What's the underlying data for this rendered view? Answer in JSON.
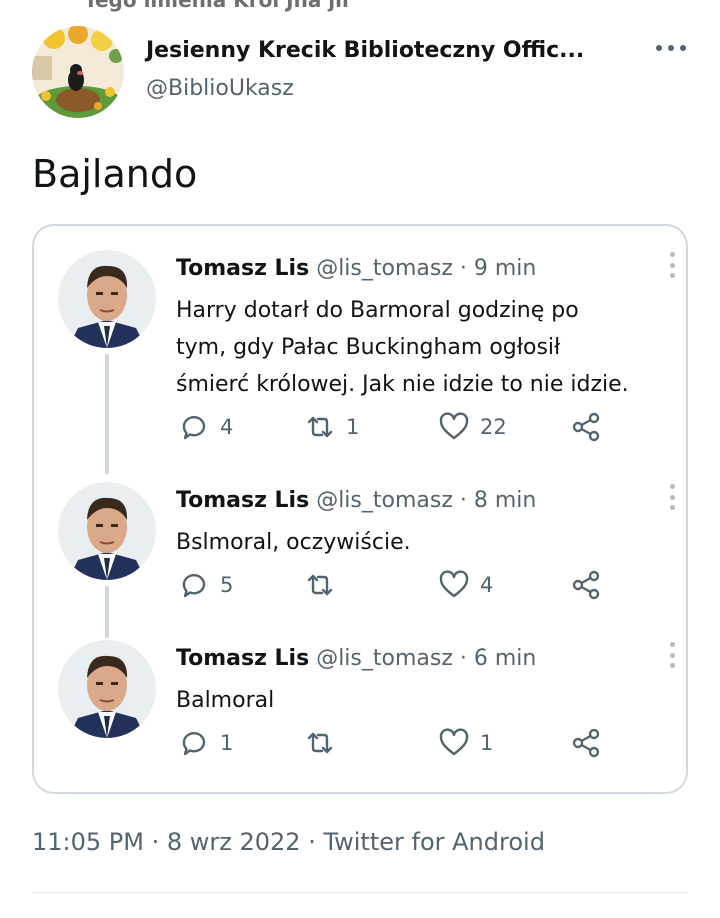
{
  "top_clip": "Tego imienia Król Jna jii",
  "author": {
    "name": "Jesienny Krecik Biblioteczny Offic...",
    "handle": "@BiblioUkasz",
    "avatar_icon": "mole-cartoon-avatar"
  },
  "tweet": {
    "text": "Bajlando",
    "timestamp": "11:05 PM · 8 wrz 2022 · Twitter for Android"
  },
  "quoted": [
    {
      "name": "Tomasz Lis",
      "meta": "@lis_tomasz · 9 min",
      "lines": [
        "Harry dotarł do Barmoral godzinę po",
        "tym, gdy Pałac Buckingham ogłosił",
        "śmierć królowej. Jak nie idzie to nie idzie."
      ],
      "replies": "4",
      "retweets": "1",
      "likes": "22"
    },
    {
      "name": "Tomasz Lis",
      "meta": "@lis_tomasz · 8 min",
      "lines": [
        "Bslmoral, oczywiście."
      ],
      "replies": "5",
      "retweets": "",
      "likes": "4"
    },
    {
      "name": "Tomasz Lis",
      "meta": "@lis_tomasz · 6 min",
      "lines": [
        "Balmoral"
      ],
      "replies": "1",
      "retweets": "",
      "likes": "1"
    }
  ],
  "icons": {
    "reply": "reply-icon",
    "retweet": "retweet-icon",
    "like": "like-icon",
    "share": "share-icon",
    "more": "more-icon"
  },
  "colors": {
    "text": "#0f1419",
    "secondary": "#536471",
    "border": "#cfd9de"
  }
}
